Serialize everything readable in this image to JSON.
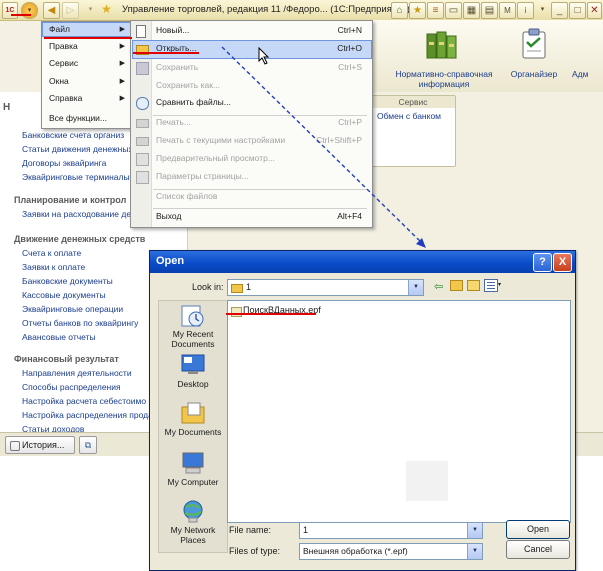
{
  "colors": {
    "accent": "#0a4cc8",
    "underline": "#e00000",
    "link": "#1b3d8e"
  },
  "app": {
    "title": "Управление торговлей, редакция 11 /Федоро... (1С:Предприятие)",
    "logo": "1С",
    "icons": [
      "menu-circle-icon",
      "back-arrow-icon",
      "forward-arrow-icon",
      "star-icon",
      "home-icon",
      "favorites-icon",
      "history-icon",
      "info-icon",
      "chevron-down-icon",
      "minimize-icon",
      "close-icon"
    ]
  },
  "sections": [
    {
      "label": "Нормативно-справочная информация"
    },
    {
      "label": "Органайзер"
    },
    {
      "label": "Адм"
    }
  ],
  "service": {
    "title": "Сервис",
    "item": "Обмен с банком"
  },
  "leftnav": {
    "initial_letter": "Н",
    "top_items": [
      "Банковские счета организ",
      "Статьи движения денежных",
      "Договоры эквайринга",
      "Эквайринговые терминалы"
    ],
    "groups": [
      {
        "title": "Планирование и контрол",
        "items": [
          "Заявки на расходование ден"
        ]
      },
      {
        "title": "Движение денежных средств",
        "items": [
          "Счета к оплате",
          "Заявки к оплате",
          "Банковские документы",
          "Кассовые документы",
          "Эквайринговые операции",
          "Отчеты банков по эквайрингу",
          "Авансовые отчеты"
        ]
      },
      {
        "title": "Финансовый результат",
        "items": [
          "Направления деятельности",
          "Способы распределения",
          "Настройка расчета себестоимо",
          "Настройка распределения прода",
          "Статьи доходов"
        ]
      }
    ]
  },
  "bottombar": {
    "history_label": "История..."
  },
  "mainmenu": {
    "items": [
      {
        "label": "Файл"
      },
      {
        "label": "Правка"
      },
      {
        "label": "Сервис"
      },
      {
        "label": "Окна"
      },
      {
        "label": "Справка"
      },
      {
        "label": "Все функции..."
      }
    ]
  },
  "filemenu": {
    "items": [
      {
        "label": "Новый...",
        "shortcut": "Ctrl+N",
        "enabled": true
      },
      {
        "label": "Открыть...",
        "shortcut": "Ctrl+O",
        "enabled": true
      },
      {
        "label": "Сохранить",
        "shortcut": "Ctrl+S",
        "enabled": false
      },
      {
        "label": "Сохранить как...",
        "shortcut": "",
        "enabled": false
      },
      {
        "label": "Сравнить файлы...",
        "shortcut": "",
        "enabled": true
      },
      {
        "label": "Печать...",
        "shortcut": "Ctrl+P",
        "enabled": false
      },
      {
        "label": "Печать с текущими настройками",
        "shortcut": "Ctrl+Shift+P",
        "enabled": false
      },
      {
        "label": "Предварительный просмотр...",
        "shortcut": "",
        "enabled": false
      },
      {
        "label": "Параметры страницы...",
        "shortcut": "",
        "enabled": false
      },
      {
        "label": "Список файлов",
        "shortcut": "",
        "enabled": false
      },
      {
        "label": "Выход",
        "shortcut": "Alt+F4",
        "enabled": true
      }
    ]
  },
  "dialog": {
    "title": "Open",
    "help_button": "?",
    "close_button": "X",
    "look_in_label": "Look in:",
    "look_in_value": "1",
    "places": [
      {
        "label": "My Recent Documents",
        "icon": "recent-documents-icon"
      },
      {
        "label": "Desktop",
        "icon": "desktop-icon"
      },
      {
        "label": "My Documents",
        "icon": "my-documents-icon"
      },
      {
        "label": "My Computer",
        "icon": "my-computer-icon"
      },
      {
        "label": "My Network Places",
        "icon": "network-places-icon"
      }
    ],
    "files": [
      "ПоискВДанных.epf"
    ],
    "file_name_label": "File name:",
    "file_name_value": "1",
    "file_type_label": "Files of type:",
    "file_type_value": "Внешняя обработка (*.epf)",
    "open_button": "Open",
    "cancel_button": "Cancel"
  }
}
